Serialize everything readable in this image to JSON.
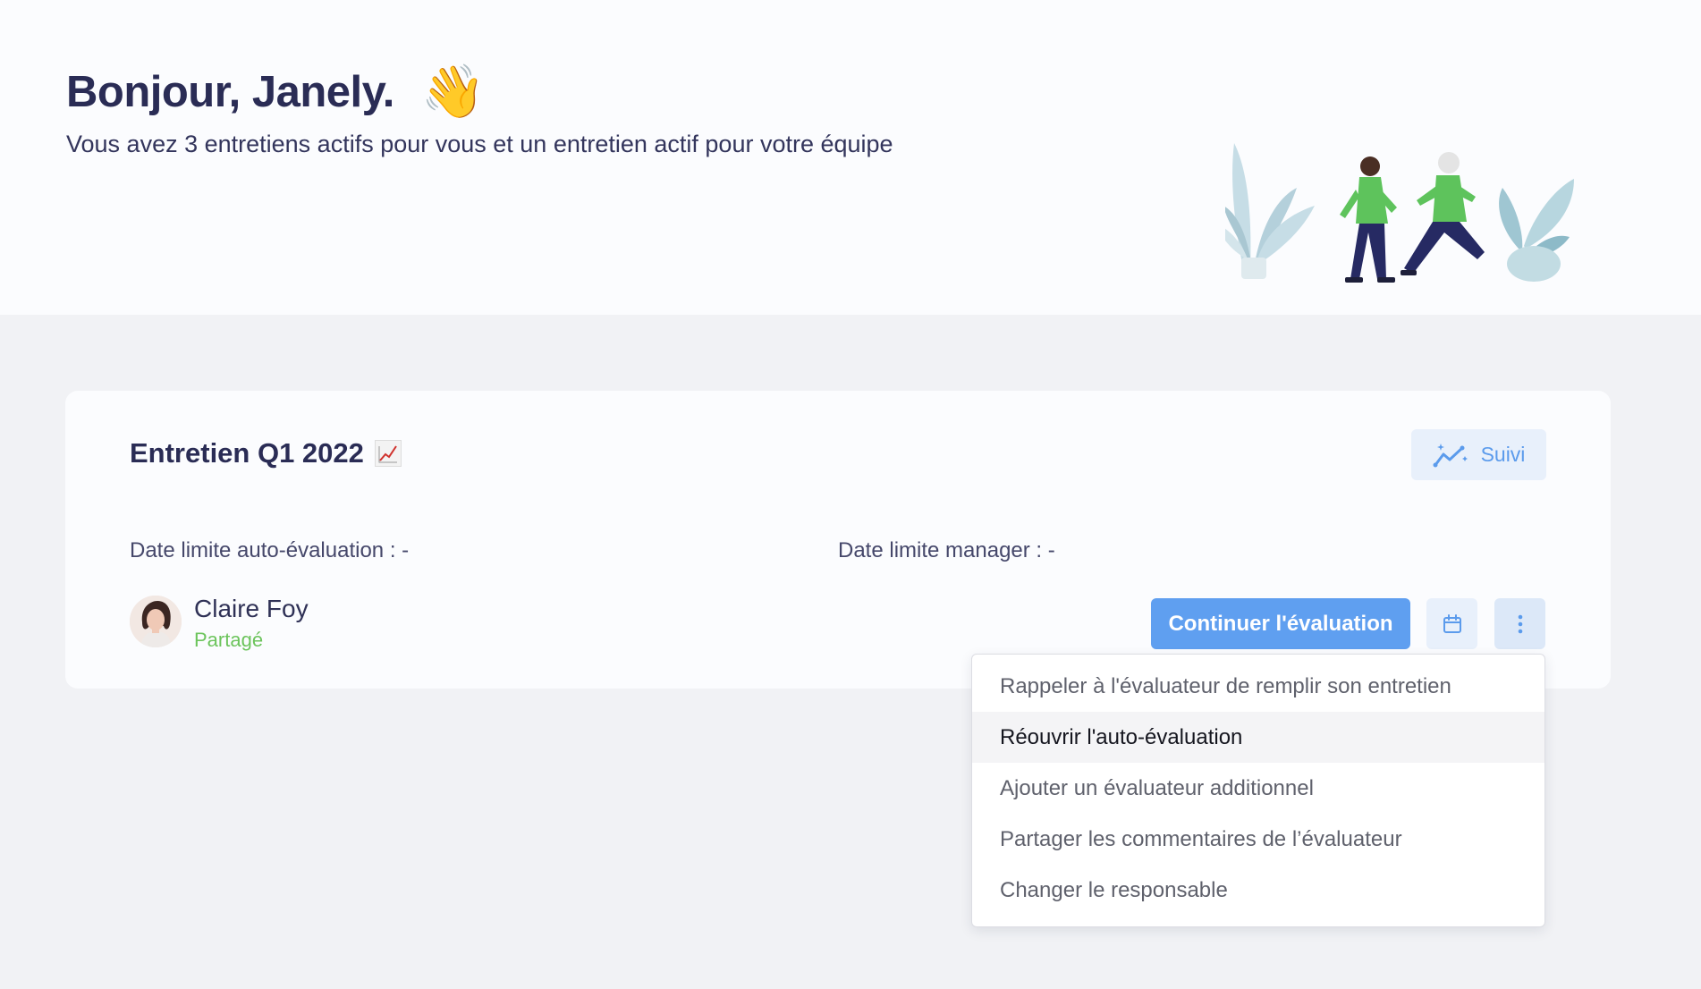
{
  "header": {
    "greeting": "Bonjour, Janely.",
    "wave_emoji": "👋",
    "subtitle": "Vous avez 3 entretiens actifs pour vous et un entretien actif pour votre équipe"
  },
  "card": {
    "title": "Entretien Q1 2022",
    "title_icon": "chart-increasing-icon",
    "suivi_label": "Suivi",
    "suivi_icon": "trend-sparkle-icon",
    "self_deadline": "Date limite auto-évaluation : -",
    "manager_deadline": "Date limite manager : -",
    "person": {
      "name": "Claire Foy",
      "status": "Partagé"
    },
    "continue_label": "Continuer l'évaluation"
  },
  "menu": {
    "items": [
      "Rappeler à l'évaluateur de remplir son entretien",
      "Réouvrir l'auto-évaluation",
      "Ajouter un évaluateur additionnel",
      "Partager les commentaires de l’évaluateur",
      "Changer le responsable"
    ],
    "highlighted_index": 1
  },
  "colors": {
    "accent": "#5f9ff0",
    "accent_light": "#e8f0fb",
    "status_green": "#6cc45c",
    "text_dark": "#2a2c55",
    "page_bg": "#f1f2f5"
  }
}
